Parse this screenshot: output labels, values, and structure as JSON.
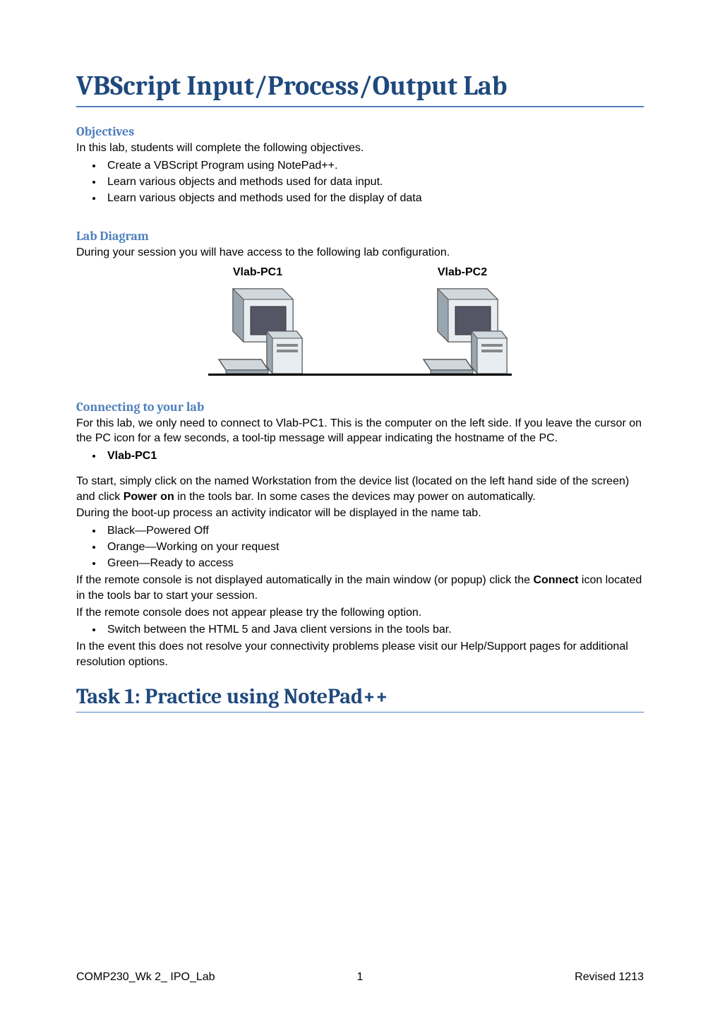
{
  "title": "VBScript Input/Process/Output Lab",
  "sections": {
    "objectives": {
      "heading": "Objectives",
      "intro": "In this lab, students will complete the following objectives.",
      "items": [
        "Create a VBScript Program using NotePad++.",
        "Learn various objects and methods used for data input.",
        "Learn various objects and methods used for the display of data"
      ]
    },
    "lab_diagram": {
      "heading": "Lab Diagram",
      "intro": "During your session you will have access to the following lab configuration.",
      "pc1_label": "Vlab-PC1",
      "pc2_label": "Vlab-PC2"
    },
    "connecting": {
      "heading": "Connecting to your lab",
      "p1": "For this lab, we only need to connect to Vlab-PC1. This is the computer on the left side. If you leave the cursor on the PC icon for a few seconds, a tool-tip message will appear indicating the hostname of the PC.",
      "device_item": "Vlab-PC1",
      "p2_pre": "To start, simply click on the named Workstation from the device list (located on the left hand side of the screen) and click ",
      "p2_bold": "Power on",
      "p2_post": " in the tools bar. In some cases the devices may power on automatically.",
      "p3": "During the boot-up process an activity indicator will be displayed in the name tab.",
      "status_items": [
        "Black—Powered Off",
        "Orange—Working on your request",
        "Green—Ready to access"
      ],
      "p4_pre": "If the remote console is not displayed automatically in the main window (or popup) click the ",
      "p4_bold": "Connect",
      "p4_post": " icon located in the tools bar to start your session.",
      "p5": "If the remote console does not appear please try the following option.",
      "option_item": "Switch between the HTML 5 and Java client versions in the tools bar.",
      "p6": "In the event this does not resolve your connectivity problems please visit our Help/Support pages for additional resolution options."
    },
    "task1_heading": "Task 1: Practice using NotePad++"
  },
  "footer": {
    "left": "COMP230_Wk 2_ IPO_Lab",
    "center": "1",
    "right": "Revised 1213"
  }
}
